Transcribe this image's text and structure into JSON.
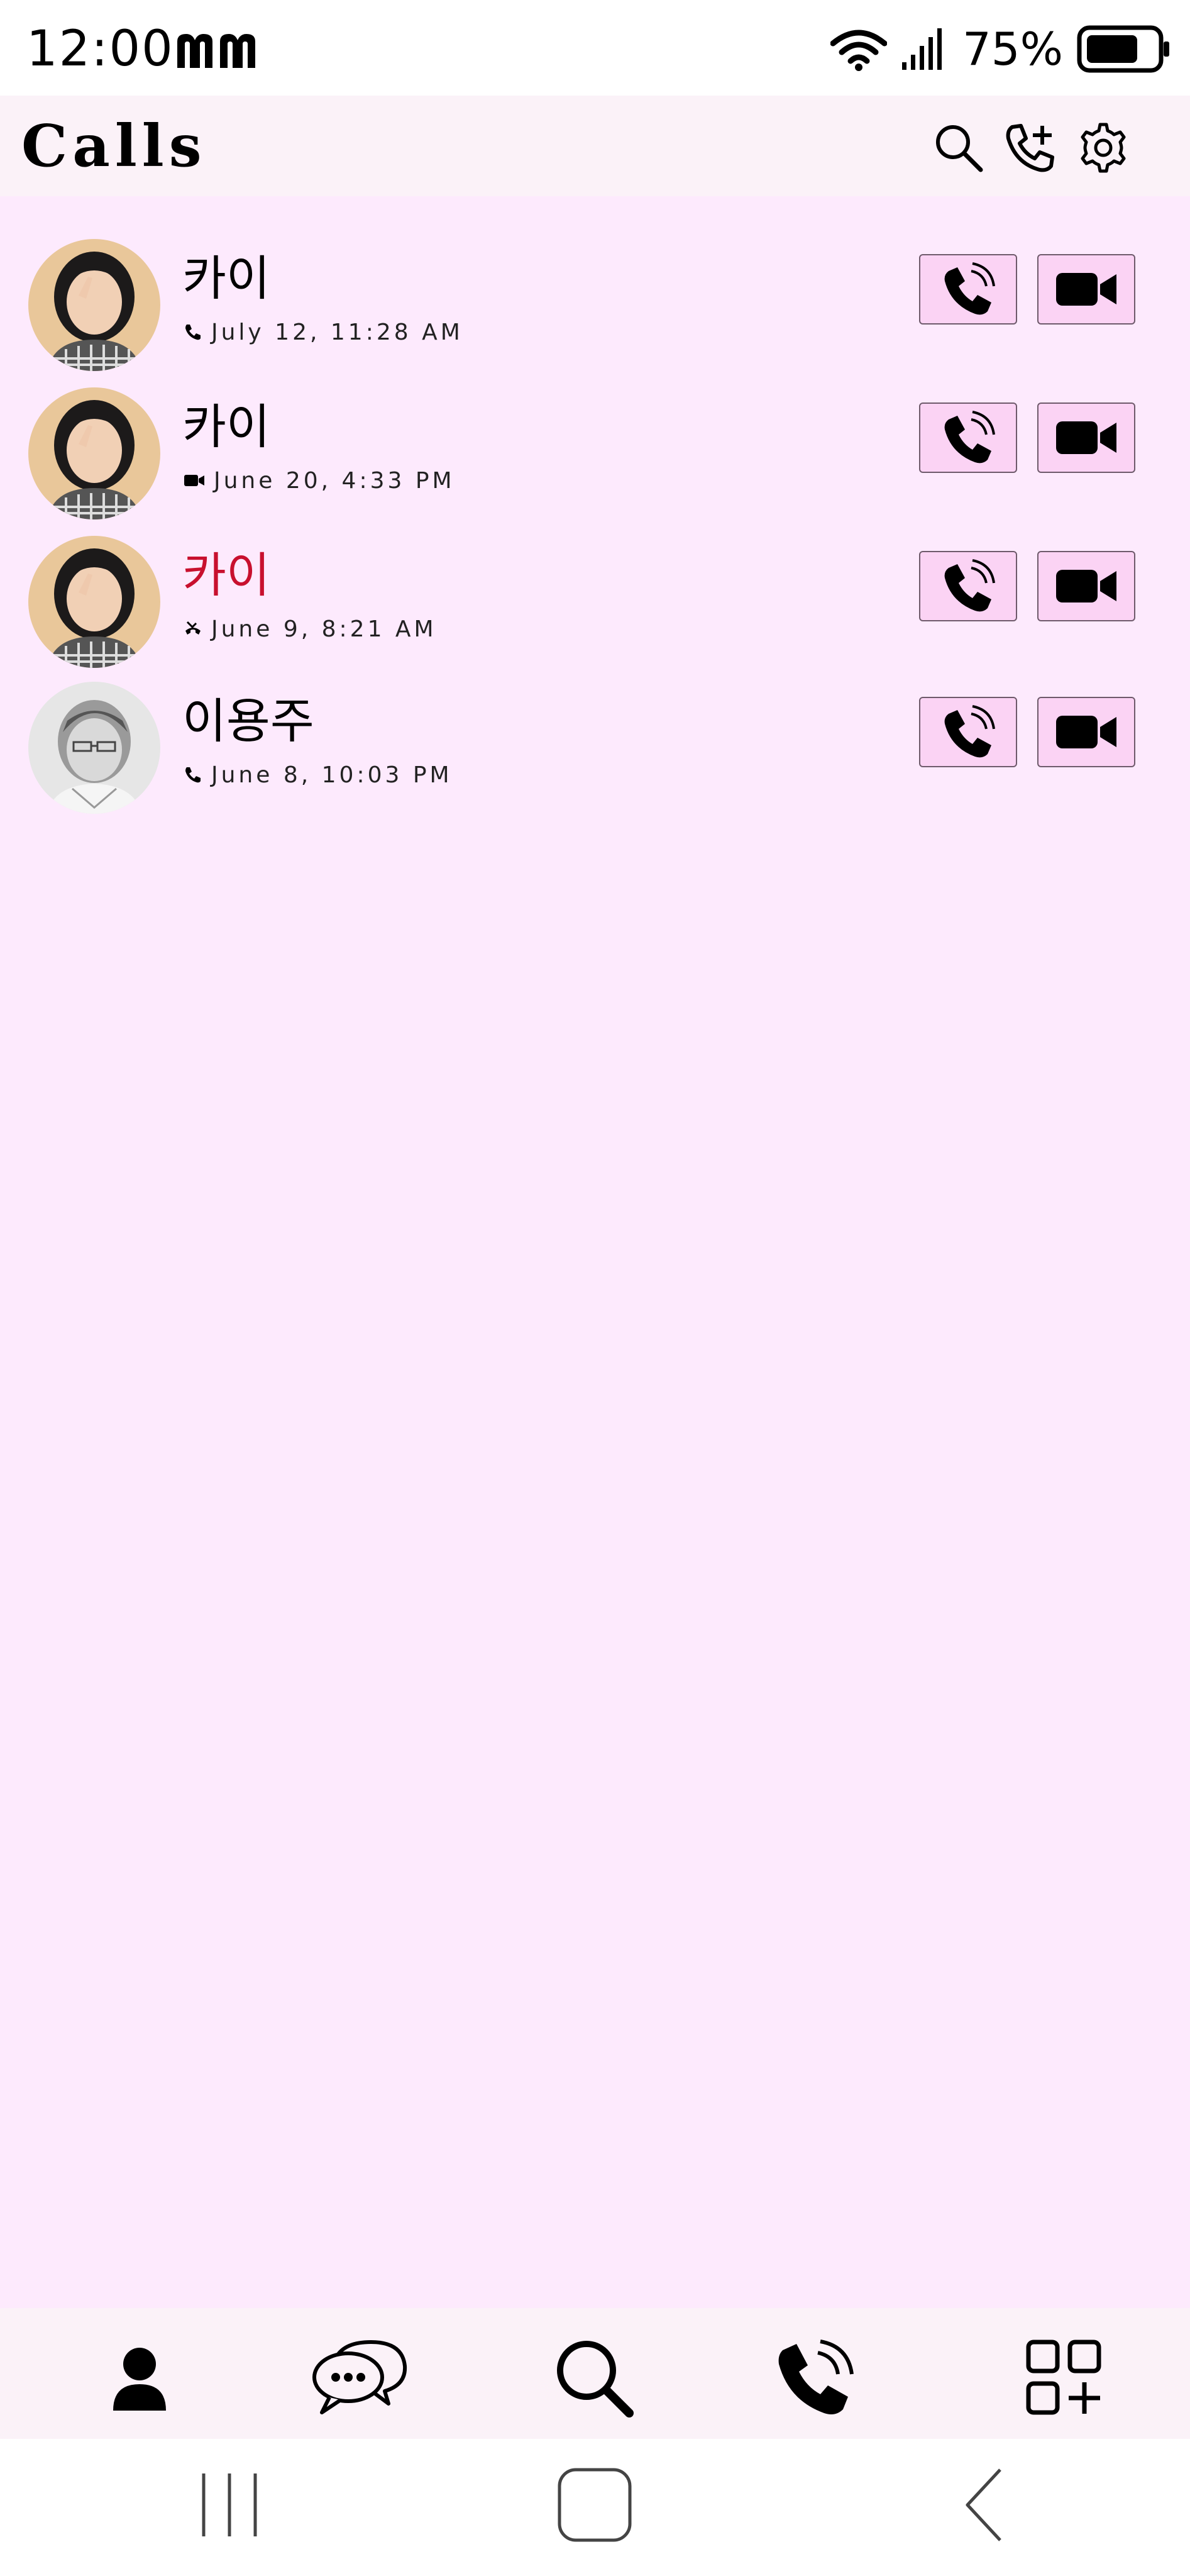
{
  "status_bar": {
    "time": "12:00",
    "battery_percent": "75%",
    "battery_level": 0.75,
    "icons": [
      "mm-logo-icon",
      "wifi-icon",
      "signal-icon",
      "battery-icon"
    ]
  },
  "header": {
    "title": "Calls",
    "icons": [
      "search-icon",
      "add-call-icon",
      "settings-icon"
    ]
  },
  "calls": [
    {
      "name": "카이",
      "call_type": "outgoing-voice",
      "date": "July 12, 11:28 AM",
      "missed": false,
      "avatar": "woman-photo"
    },
    {
      "name": "카이",
      "call_type": "video",
      "date": "June 20, 4:33 PM",
      "missed": false,
      "avatar": "woman-photo"
    },
    {
      "name": "카이",
      "call_type": "missed-voice",
      "date": "June 9, 8:21 AM",
      "missed": true,
      "avatar": "woman-photo"
    },
    {
      "name": "이용주",
      "call_type": "outgoing-voice",
      "date": "June 8, 10:03 PM",
      "missed": false,
      "avatar": "man-sketch"
    }
  ],
  "row_actions": [
    "voice-call-button",
    "video-call-button"
  ],
  "bottom_nav": [
    "contacts-icon",
    "chats-icon",
    "search-icon",
    "calls-icon",
    "more-apps-icon"
  ],
  "system_nav": [
    "recent-apps-button",
    "home-button",
    "back-button"
  ],
  "colors": {
    "background": "#fdeafd",
    "header_bg": "#fbf2f8",
    "action_button_bg": "#fbd3f4",
    "missed_red": "#c8102e"
  }
}
